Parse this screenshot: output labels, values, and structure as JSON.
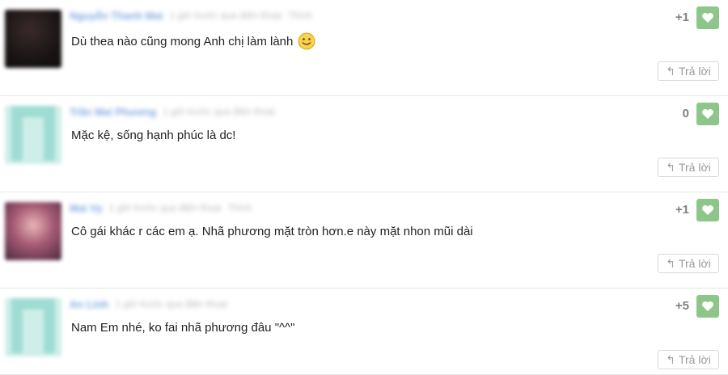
{
  "comments": [
    {
      "author": "Nguyễn Thanh Mai",
      "meta": "1 giờ trước qua điện thoại",
      "meta2": "Thích",
      "text": "Dù thea nào cũng mong Anh chị làm lành",
      "score": "+1",
      "avatar_icon": "avatar-dark-photo",
      "has_emoji": true,
      "reply_label": "Trả lời"
    },
    {
      "author": "Trần Mai Phương",
      "meta": "1 giờ trước qua điện thoại",
      "meta2": "",
      "text": "Mặc kệ, sống hạnh phúc là dc!",
      "score": "0",
      "avatar_icon": "avatar-default",
      "has_emoji": false,
      "reply_label": "Trả lời"
    },
    {
      "author": "Mai Vy",
      "meta": "1 giờ trước qua điện thoại",
      "meta2": "Thích",
      "text": "Cô gái khác r các em ạ. Nhã phương mặt tròn hơn.e này mặt nhon mũi dài",
      "score": "+1",
      "avatar_icon": "avatar-girl-photo",
      "has_emoji": false,
      "reply_label": "Trả lời"
    },
    {
      "author": "An Linh",
      "meta": "1 giờ trước qua điện thoại",
      "meta2": "",
      "text": "Nam Em nhé, ko fai nhã phương đâu \"^^\"",
      "score": "+5",
      "avatar_icon": "avatar-default",
      "has_emoji": false,
      "reply_label": "Trả lời"
    }
  ],
  "icons": {
    "like": "heart-icon",
    "reply": "reply-arrow-icon",
    "emoji": "smiley-icon"
  },
  "colors": {
    "like_button": "#8ec68a",
    "author_link": "#7fa8de",
    "score": "#808080"
  }
}
